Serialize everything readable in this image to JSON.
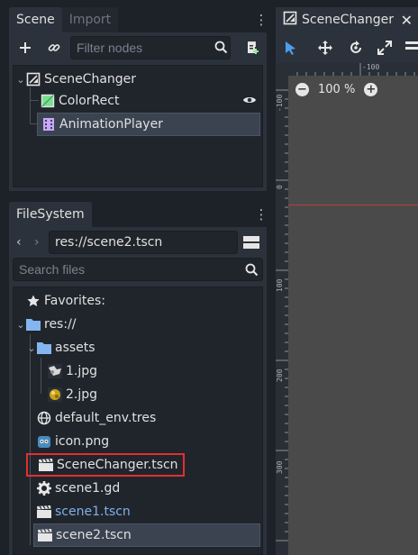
{
  "scene_dock": {
    "tabs": [
      {
        "label": "Scene",
        "active": true
      },
      {
        "label": "Import",
        "active": false
      }
    ],
    "filter_placeholder": "Filter nodes",
    "nodes": [
      {
        "label": "SceneChanger",
        "icon": "scene-root-icon"
      },
      {
        "label": "ColorRect",
        "icon": "colorrect-icon"
      },
      {
        "label": "AnimationPlayer",
        "icon": "animationplayer-icon",
        "selected": true
      }
    ]
  },
  "filesystem_dock": {
    "tab_label": "FileSystem",
    "path": "res://scene2.tscn",
    "search_placeholder": "Search files",
    "items": [
      {
        "label": "Favorites:",
        "icon": "star-icon"
      },
      {
        "label": "res://",
        "icon": "folder-icon"
      },
      {
        "label": "assets",
        "icon": "folder-icon"
      },
      {
        "label": "1.jpg",
        "icon": "image-thumbnail-icon"
      },
      {
        "label": "2.jpg",
        "icon": "image-thumbnail-icon"
      },
      {
        "label": "default_env.tres",
        "icon": "environment-icon"
      },
      {
        "label": "icon.png",
        "icon": "godot-icon"
      },
      {
        "label": "SceneChanger.tscn",
        "icon": "clapperboard-icon",
        "highlighted": true
      },
      {
        "label": "scene1.gd",
        "icon": "gear-icon"
      },
      {
        "label": "scene1.tscn",
        "icon": "clapperboard-icon",
        "color": "#7fb0ea"
      },
      {
        "label": "scene2.tscn",
        "icon": "clapperboard-icon",
        "selected": true
      }
    ]
  },
  "viewport": {
    "tab_label": "SceneChanger",
    "zoom": "100 %",
    "ruler_h": [
      "-100"
    ],
    "ruler_v": [
      "-100",
      "0",
      "100",
      "200",
      "300"
    ]
  },
  "colors": {
    "accent": "#4c9eed",
    "highlight_box": "#e03030",
    "origin_line": "#c03c3c"
  }
}
